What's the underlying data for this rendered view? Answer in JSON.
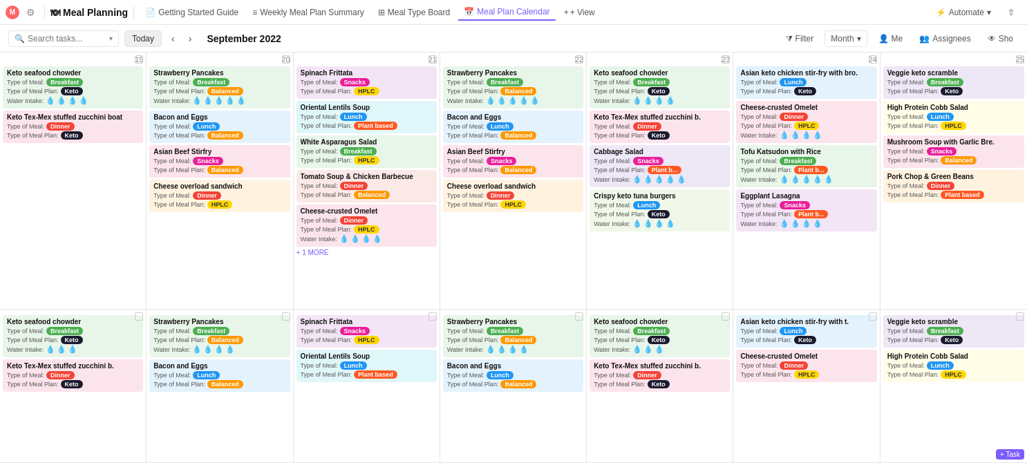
{
  "app": {
    "title": "Meal Planning",
    "avatar_text": "M",
    "tabs": [
      {
        "label": "Getting Started Guide",
        "icon": "📄",
        "active": false
      },
      {
        "label": "Weekly Meal Plan Summary",
        "icon": "≡",
        "active": false
      },
      {
        "label": "Meal Type Board",
        "icon": "⊞",
        "active": false
      },
      {
        "label": "Meal Plan Calendar",
        "icon": "📅",
        "active": true
      },
      {
        "label": "+ View",
        "icon": "",
        "active": false
      }
    ],
    "nav_right": [
      {
        "label": "Automate"
      },
      {
        "label": "Share"
      }
    ]
  },
  "toolbar": {
    "search_placeholder": "Search tasks...",
    "today_label": "Today",
    "month": "September 2022",
    "filter_label": "Filter",
    "month_label": "Month",
    "me_label": "Me",
    "assignees_label": "Assignees",
    "show_label": "Sho"
  },
  "calendar": {
    "week1": [
      {
        "day": "19",
        "is_overflow": true,
        "cards": [
          {
            "title": "Keto seafood chowder",
            "bg": "bg-green",
            "meal_type": "Breakfast",
            "meal_badge": "badge-breakfast",
            "plan_type": "Keto",
            "plan_badge": "badge-keto",
            "water": 4
          },
          {
            "title": "Keto Tex-Mex stuffed zucchini boat",
            "bg": "bg-pink",
            "meal_type": "Dinner",
            "meal_badge": "badge-dinner",
            "plan_type": "Keto",
            "plan_badge": "badge-keto",
            "water": 0
          }
        ]
      },
      {
        "day": "20",
        "cards": [
          {
            "title": "Strawberry Pancakes",
            "bg": "bg-green",
            "meal_type": "Breakfast",
            "meal_badge": "badge-breakfast",
            "plan_type": "Balanced",
            "plan_badge": "badge-balanced",
            "water": 5
          },
          {
            "title": "Bacon and Eggs",
            "bg": "bg-blue",
            "meal_type": "Lunch",
            "meal_badge": "badge-lunch",
            "plan_type": "Balanced",
            "plan_badge": "badge-balanced",
            "water": 0
          },
          {
            "title": "Asian Beef Stirfry",
            "bg": "bg-pink",
            "meal_type": "Snacks",
            "meal_badge": "badge-snacks",
            "plan_type": "Balanced",
            "plan_badge": "badge-balanced",
            "water": 0
          },
          {
            "title": "Cheese overload sandwich",
            "bg": "bg-orange",
            "meal_type": "Dinner",
            "meal_badge": "badge-dinner",
            "plan_type": "HPLC",
            "plan_badge": "badge-hplc",
            "water": 0
          }
        ]
      },
      {
        "day": "21",
        "has_more": true,
        "cards": [
          {
            "title": "Spinach Frittata",
            "bg": "bg-purple",
            "meal_type": "Snacks",
            "meal_badge": "badge-snacks",
            "plan_type": "HPLC",
            "plan_badge": "badge-hplc",
            "water": 0
          },
          {
            "title": "Oriental Lentils Soup",
            "bg": "bg-teal",
            "meal_type": "Lunch",
            "meal_badge": "badge-lunch",
            "plan_type": "Plant based",
            "plan_badge": "badge-plant",
            "water": 0
          },
          {
            "title": "White Asparagus Salad",
            "bg": "bg-green",
            "meal_type": "Breakfast",
            "meal_badge": "badge-breakfast",
            "plan_type": "HPLC",
            "plan_badge": "badge-hplc",
            "water": 0
          },
          {
            "title": "Tomato Soup & Chicken Barbecue",
            "bg": "bg-salmon",
            "meal_type": "Dinner",
            "meal_badge": "badge-dinner",
            "plan_type": "Balanced",
            "plan_badge": "badge-balanced",
            "water": 0
          },
          {
            "title": "Cheese-crusted Omelet",
            "bg": "bg-pink",
            "meal_type": "Dinner",
            "meal_badge": "badge-dinner",
            "plan_type": "HPLC",
            "plan_badge": "badge-hplc",
            "water": 4
          }
        ],
        "more_label": "+ 1 MORE"
      },
      {
        "day": "22",
        "cards": [
          {
            "title": "Strawberry Pancakes",
            "bg": "bg-green",
            "meal_type": "Breakfast",
            "meal_badge": "badge-breakfast",
            "plan_type": "Balanced",
            "plan_badge": "badge-balanced",
            "water": 5
          },
          {
            "title": "Bacon and Eggs",
            "bg": "bg-blue",
            "meal_type": "Lunch",
            "meal_badge": "badge-lunch",
            "plan_type": "Balanced",
            "plan_badge": "badge-balanced",
            "water": 0
          },
          {
            "title": "Asian Beef Stirfry",
            "bg": "bg-pink",
            "meal_type": "Snacks",
            "meal_badge": "badge-snacks",
            "plan_type": "Balanced",
            "plan_badge": "badge-balanced",
            "water": 0
          },
          {
            "title": "Cheese overload sandwich",
            "bg": "bg-orange",
            "meal_type": "Dinner",
            "meal_badge": "badge-dinner",
            "plan_type": "HPLC",
            "plan_badge": "badge-hplc",
            "water": 0
          }
        ]
      },
      {
        "day": "23",
        "cards": [
          {
            "title": "Keto seafood chowder",
            "bg": "bg-green",
            "meal_type": "Breakfast",
            "meal_badge": "badge-breakfast",
            "plan_type": "Keto",
            "plan_badge": "badge-keto",
            "water": 4
          },
          {
            "title": "Keto Tex-Mex stuffed zucchini b.",
            "bg": "bg-pink",
            "meal_type": "Dinner",
            "meal_badge": "badge-dinner",
            "plan_type": "Keto",
            "plan_badge": "badge-keto",
            "water": 0
          },
          {
            "title": "Cabbage Salad",
            "bg": "bg-lavender",
            "meal_type": "Snacks",
            "meal_badge": "badge-snacks",
            "plan_type": "Plant b...",
            "plan_badge": "badge-plant",
            "water": 5
          },
          {
            "title": "Crispy keto tuna burgers",
            "bg": "bg-mint",
            "meal_type": "Lunch",
            "meal_badge": "badge-lunch",
            "plan_type": "Keto",
            "plan_badge": "badge-keto",
            "water": 4
          }
        ]
      },
      {
        "day": "24",
        "cards": [
          {
            "title": "Asian keto chicken stir-fry with bro.",
            "bg": "bg-blue",
            "meal_type": "Lunch",
            "meal_badge": "badge-lunch",
            "plan_type": "Keto",
            "plan_badge": "badge-keto",
            "water": 0
          },
          {
            "title": "Cheese-crusted Omelet",
            "bg": "bg-pink",
            "meal_type": "Dinner",
            "meal_badge": "badge-dinner",
            "plan_type": "HPLC",
            "plan_badge": "badge-hplc",
            "water": 4
          },
          {
            "title": "Tofu Katsudon with Rice",
            "bg": "bg-green",
            "meal_type": "Breakfast",
            "meal_badge": "badge-breakfast",
            "plan_type": "Plant b...",
            "plan_badge": "badge-plant",
            "water": 5
          },
          {
            "title": "Eggplant Lasagna",
            "bg": "bg-purple",
            "meal_type": "Snacks",
            "meal_badge": "badge-snacks",
            "plan_type": "Plant b...",
            "plan_badge": "badge-plant",
            "water": 4
          }
        ]
      },
      {
        "day": "25",
        "cards": [
          {
            "title": "Veggie keto scramble",
            "bg": "bg-lavender",
            "meal_type": "Breakfast",
            "meal_badge": "badge-breakfast",
            "plan_type": "Keto",
            "plan_badge": "badge-keto",
            "water": 0
          },
          {
            "title": "High Protein Cobb Salad",
            "bg": "bg-yellow",
            "meal_type": "Lunch",
            "meal_badge": "badge-lunch",
            "plan_type": "HPLC",
            "plan_badge": "badge-hplc",
            "water": 0
          },
          {
            "title": "Mushroom Soup with Garlic Bre.",
            "bg": "bg-pink",
            "meal_type": "Snacks",
            "meal_badge": "badge-snacks",
            "plan_type": "Balanced",
            "plan_badge": "badge-balanced",
            "water": 0
          },
          {
            "title": "Pork Chop & Green Beans",
            "bg": "bg-orange",
            "meal_type": "Dinner",
            "meal_badge": "badge-dinner",
            "plan_type": "Plant based",
            "plan_badge": "badge-plant",
            "water": 0
          }
        ]
      }
    ],
    "week2": [
      {
        "day": "",
        "is_overflow": true,
        "cards": [
          {
            "title": "Keto seafood chowder",
            "bg": "bg-green",
            "meal_type": "Breakfast",
            "meal_badge": "badge-breakfast",
            "plan_type": "Keto",
            "plan_badge": "badge-keto",
            "water": 3
          },
          {
            "title": "Keto Tex-Mex stuffed zucchini b.",
            "bg": "bg-pink",
            "meal_type": "Dinner",
            "meal_badge": "badge-dinner",
            "plan_type": "Keto",
            "plan_badge": "badge-keto",
            "water": 0
          }
        ]
      },
      {
        "day": "",
        "cards": [
          {
            "title": "Strawberry Pancakes",
            "bg": "bg-green",
            "meal_type": "Breakfast",
            "meal_badge": "badge-breakfast",
            "plan_type": "Balanced",
            "plan_badge": "badge-balanced",
            "water": 4
          },
          {
            "title": "Bacon and Eggs",
            "bg": "bg-blue",
            "meal_type": "Lunch",
            "meal_badge": "badge-lunch",
            "plan_type": "Balanced",
            "plan_badge": "badge-balanced",
            "water": 0
          }
        ]
      },
      {
        "day": "",
        "cards": [
          {
            "title": "Spinach Frittata",
            "bg": "bg-purple",
            "meal_type": "Snacks",
            "meal_badge": "badge-snacks",
            "plan_type": "HPLC",
            "plan_badge": "badge-hplc",
            "water": 0
          },
          {
            "title": "Oriental Lentils Soup",
            "bg": "bg-teal",
            "meal_type": "Lunch",
            "meal_badge": "badge-lunch",
            "plan_type": "Plant based",
            "plan_badge": "badge-plant",
            "water": 0
          }
        ]
      },
      {
        "day": "",
        "cards": [
          {
            "title": "Strawberry Pancakes",
            "bg": "bg-green",
            "meal_type": "Breakfast",
            "meal_badge": "badge-breakfast",
            "plan_type": "Balanced",
            "plan_badge": "badge-balanced",
            "water": 4
          },
          {
            "title": "Bacon and Eggs",
            "bg": "bg-blue",
            "meal_type": "Lunch",
            "meal_badge": "badge-lunch",
            "plan_type": "Balanced",
            "plan_badge": "badge-balanced",
            "water": 0
          }
        ]
      },
      {
        "day": "",
        "cards": [
          {
            "title": "Keto seafood chowder",
            "bg": "bg-green",
            "meal_type": "Breakfast",
            "meal_badge": "badge-breakfast",
            "plan_type": "Keto",
            "plan_badge": "badge-keto",
            "water": 3
          },
          {
            "title": "Keto Tex-Mex stuffed zucchini b.",
            "bg": "bg-pink",
            "meal_type": "Dinner",
            "meal_badge": "badge-dinner",
            "plan_type": "Keto",
            "plan_badge": "badge-keto",
            "water": 0
          }
        ]
      },
      {
        "day": "",
        "cards": [
          {
            "title": "Asian keto chicken stir-fry with t.",
            "bg": "bg-blue",
            "meal_type": "Lunch",
            "meal_badge": "badge-lunch",
            "plan_type": "Keto",
            "plan_badge": "badge-keto",
            "water": 0
          },
          {
            "title": "Cheese-crusted Omelet",
            "bg": "bg-pink",
            "meal_type": "Dinner",
            "meal_badge": "badge-dinner",
            "plan_type": "HPLC",
            "plan_badge": "badge-hplc",
            "water": 0
          }
        ]
      },
      {
        "day": "",
        "cards": [
          {
            "title": "Veggie keto scramble",
            "bg": "bg-lavender",
            "meal_type": "Breakfast",
            "meal_badge": "badge-breakfast",
            "plan_type": "Keto",
            "plan_badge": "badge-keto",
            "water": 0
          },
          {
            "title": "High Protein Cobb Salad",
            "bg": "bg-yellow",
            "meal_type": "Lunch",
            "meal_badge": "badge-lunch",
            "plan_type": "HPLC",
            "plan_badge": "badge-hplc",
            "water": 0
          }
        ],
        "has_add_task": true
      }
    ]
  }
}
